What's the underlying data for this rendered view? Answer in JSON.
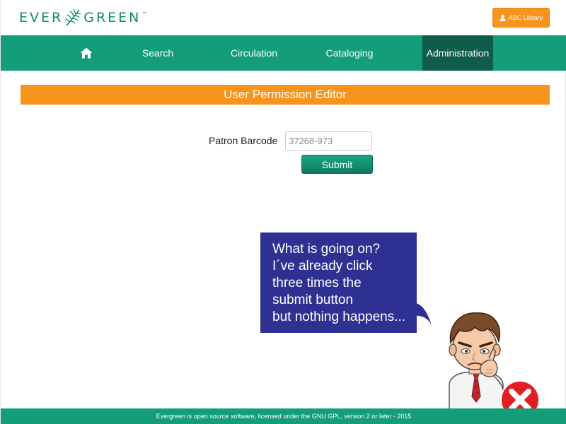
{
  "header": {
    "logo_left": "EVER",
    "logo_right": "GREEN",
    "logo_tm": "™",
    "library_button": "ABC Library"
  },
  "nav": {
    "home_icon": "home-icon",
    "items": [
      {
        "label": "Search"
      },
      {
        "label": "Circulation"
      },
      {
        "label": "Cataloging"
      },
      {
        "label": "Administration",
        "active": true
      }
    ]
  },
  "page": {
    "title": "User Permission Editor"
  },
  "form": {
    "barcode_label": "Patron Barcode",
    "barcode_placeholder": "37268-973",
    "submit_label": "Submit"
  },
  "bubble": {
    "lines": [
      "What is going on?",
      "I´ve already click",
      "three times the",
      "submit button",
      "but nothing happens..."
    ]
  },
  "footer": {
    "text": "Evergreen is open source software, licensed under the GNU GPL, version 2 or later - 2015"
  },
  "colors": {
    "brand_green": "#149d7b",
    "nav_active": "#0e5c49",
    "accent_orange": "#f7941d",
    "bubble_blue": "#2e3192",
    "error_red": "#e31e24"
  }
}
